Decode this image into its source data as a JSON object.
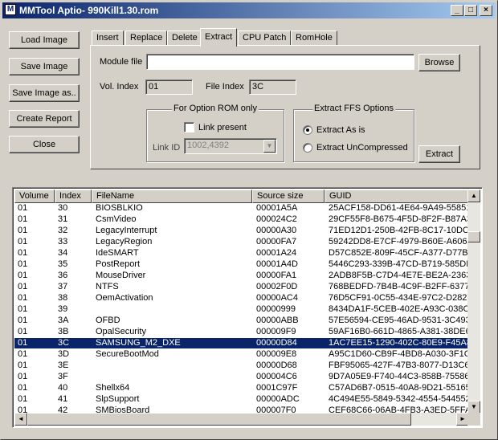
{
  "window": {
    "title": "MMTool Aptio-  990Kill1.30.rom",
    "app_icon": "M",
    "minimize": "_",
    "maximize": "□",
    "close": "×"
  },
  "left_buttons": {
    "load_image": "Load Image",
    "save_image": "Save Image",
    "save_image_as": "Save Image as..",
    "create_report": "Create Report",
    "close": "Close"
  },
  "tabs": [
    "Insert",
    "Replace",
    "Delete",
    "Extract",
    "CPU Patch",
    "RomHole"
  ],
  "active_tab": "Extract",
  "extract": {
    "module_file_label": "Module file",
    "module_file_value": "",
    "browse": "Browse",
    "vol_index_label": "Vol. Index",
    "vol_index_value": "01",
    "file_index_label": "File Index",
    "file_index_value": "3C",
    "option_rom_group": "For Option ROM only",
    "link_present_label": "Link present",
    "link_present_checked": false,
    "link_id_label": "Link ID",
    "link_id_value": "1002,4392",
    "ffs_group": "Extract FFS Options",
    "extract_as_is": "Extract As is",
    "extract_uncompressed": "Extract UnCompressed",
    "selected_option": "as_is",
    "extract_button": "Extract"
  },
  "table": {
    "columns": [
      "Volume",
      "Index",
      "FileName",
      "Source size",
      "GUID"
    ],
    "selected_index": 15,
    "rows": [
      [
        "01",
        "30",
        "BIOSBLKIO",
        "00001A5A",
        "25ACF158-DD61-4E64-9A49-55851E"
      ],
      [
        "01",
        "31",
        "CsmVideo",
        "000024C2",
        "29CF55F8-B675-4F5D-8F2F-B87A3E"
      ],
      [
        "01",
        "32",
        "LegacyInterrupt",
        "00000A30",
        "71ED12D1-250B-42FB-8C17-10DCFA"
      ],
      [
        "01",
        "33",
        "LegacyRegion",
        "00000FA7",
        "59242DD8-E7CF-4979-B60E-A6067E"
      ],
      [
        "01",
        "34",
        "IdeSMART",
        "00001A24",
        "D57C852E-809F-45CF-A377-D77BC0"
      ],
      [
        "01",
        "35",
        "PostReport",
        "00001A4D",
        "5446C293-339B-47CD-B719-585DE3"
      ],
      [
        "01",
        "36",
        "MouseDriver",
        "00000FA1",
        "2ADB8F5B-C7D4-4E7E-BE2A-23634B"
      ],
      [
        "01",
        "37",
        "NTFS",
        "00002F0D",
        "768BEDFD-7B4B-4C9F-B2FF-6377E3"
      ],
      [
        "01",
        "38",
        "OemActivation",
        "00000AC4",
        "76D5CF91-0C55-434E-97C2-D2825C"
      ],
      [
        "01",
        "39",
        "",
        "00000999",
        "8434DA1F-5CEB-402E-A93C-038CBE"
      ],
      [
        "01",
        "3A",
        "OFBD",
        "00000ABB",
        "57E56594-CE95-46AD-9531-3C4931"
      ],
      [
        "01",
        "3B",
        "OpalSecurity",
        "000009F9",
        "59AF16B0-661D-4865-A381-38DE68"
      ],
      [
        "01",
        "3C",
        "SAMSUNG_M2_DXE",
        "00000D84",
        "1AC7EE15-1290-402C-80E9-F45A86"
      ],
      [
        "01",
        "3D",
        "SecureBootMod",
        "000009E8",
        "A95C1D60-CB9F-4BD8-A030-3F1C44"
      ],
      [
        "01",
        "3E",
        "",
        "00000D68",
        "FBF95065-427F-47B3-8077-D13C607"
      ],
      [
        "01",
        "3F",
        "",
        "000004C6",
        "9D7A05E9-F740-44C3-858B-75586A8"
      ],
      [
        "01",
        "40",
        "Shellx64",
        "0001C97F",
        "C57AD6B7-0515-40A8-9D21-551652"
      ],
      [
        "01",
        "41",
        "SlpSupport",
        "00000ADC",
        "4C494E55-5849-5342-4554-5445522"
      ],
      [
        "01",
        "42",
        "SMBiosBoard",
        "000007F0",
        "CEF68C66-06AB-4FB3-A3ED-5FFA88"
      ]
    ]
  },
  "scroll": {
    "up": "▲",
    "down": "▼",
    "left": "◄",
    "right": "►",
    "combo": "▼"
  }
}
